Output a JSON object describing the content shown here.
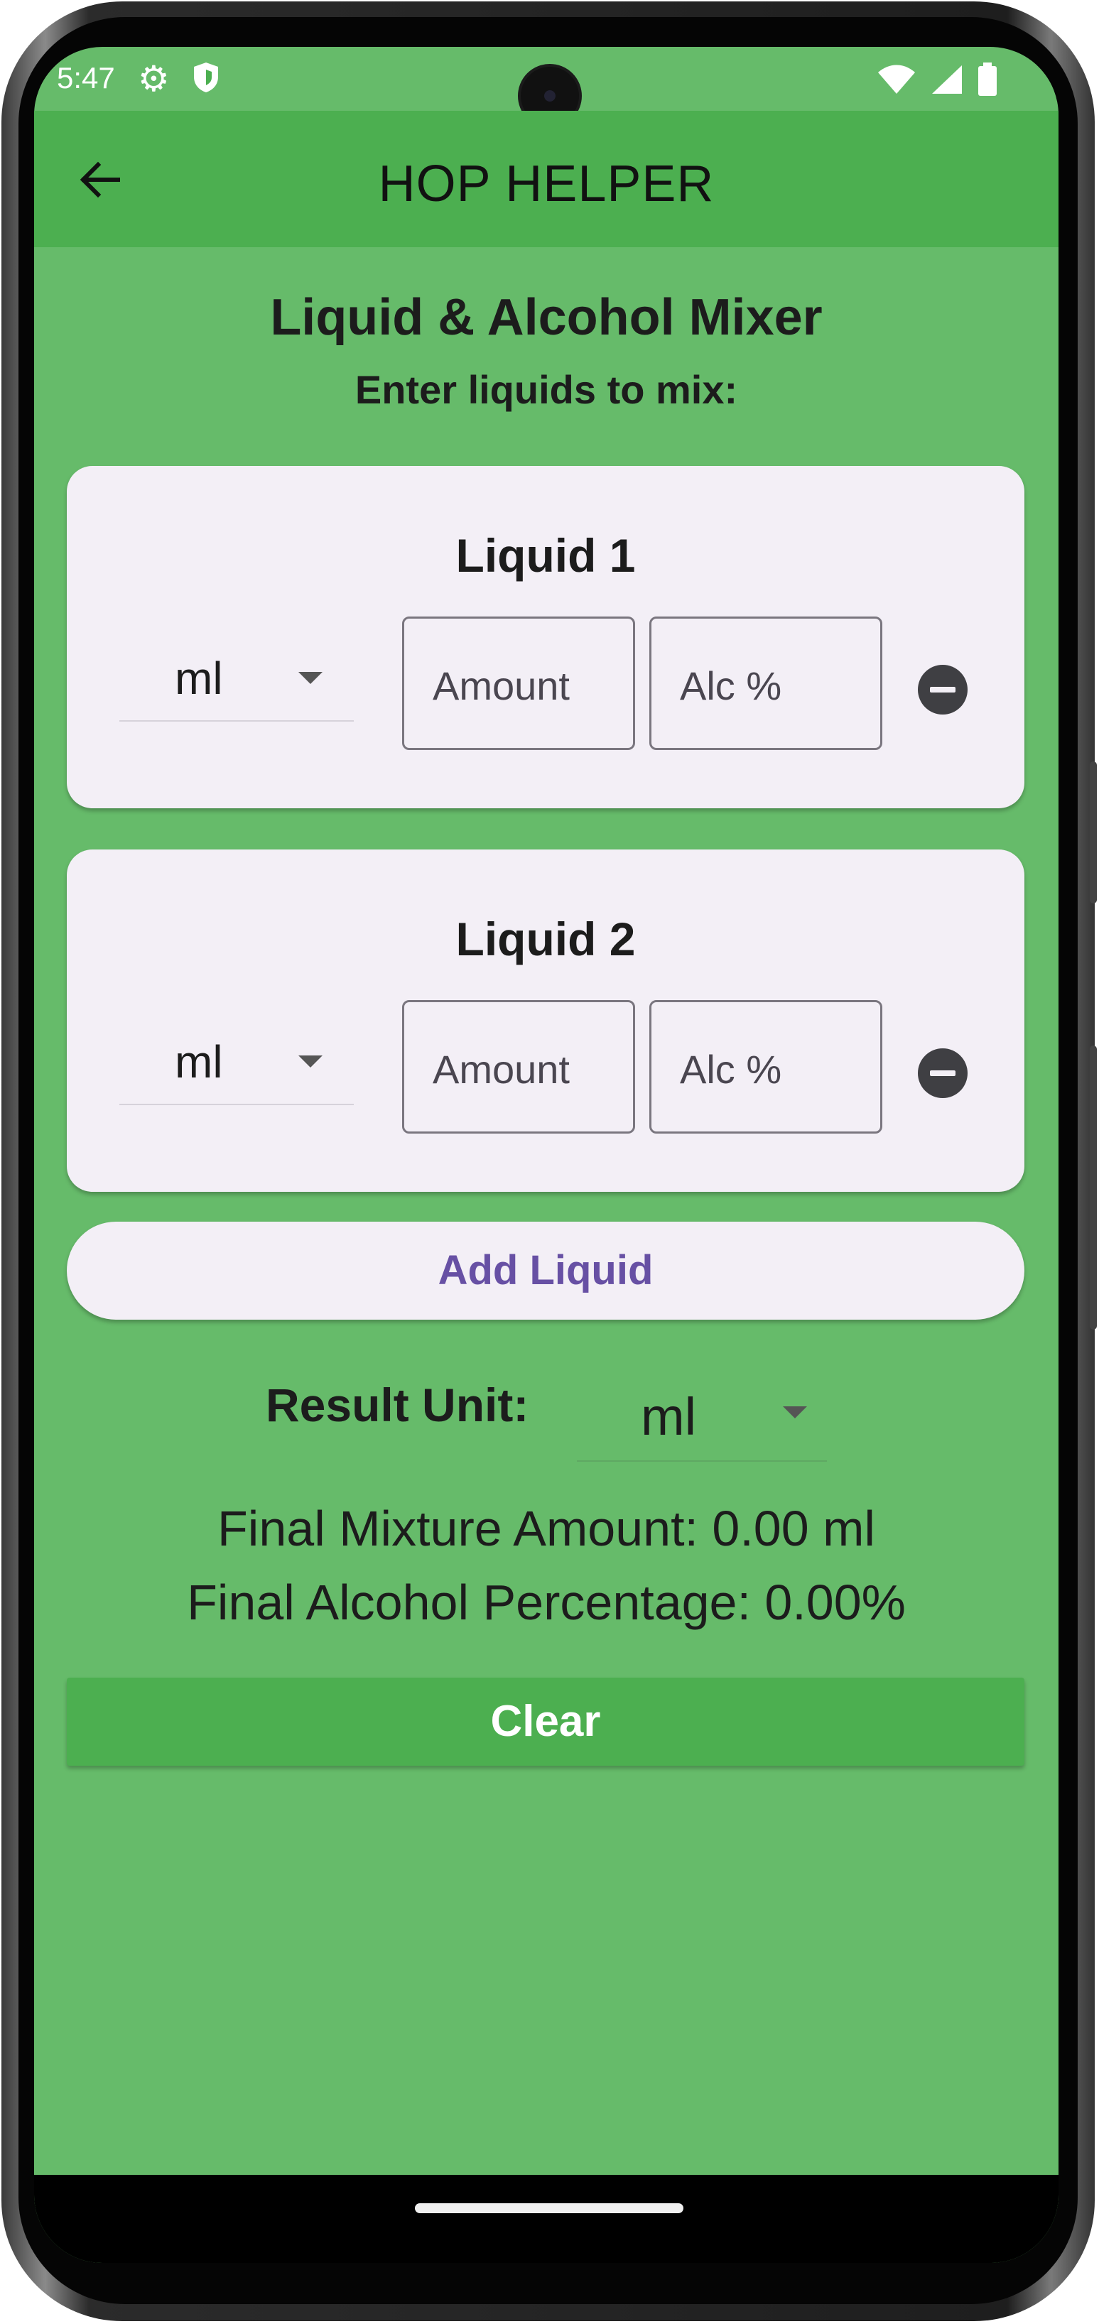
{
  "status_bar": {
    "time": "5:47",
    "icons": [
      "gear-icon",
      "shield-icon",
      "wifi-icon",
      "signal-icon",
      "battery-icon"
    ]
  },
  "app_bar": {
    "title": "HOP HELPER",
    "back_icon": "arrow-back-icon"
  },
  "page": {
    "heading": "Liquid & Alcohol Mixer",
    "subheading": "Enter liquids to mix:"
  },
  "liquids": [
    {
      "title": "Liquid 1",
      "unit": "ml",
      "amount_placeholder": "Amount",
      "alc_placeholder": "Alc %"
    },
    {
      "title": "Liquid 2",
      "unit": "ml",
      "amount_placeholder": "Amount",
      "alc_placeholder": "Alc %"
    }
  ],
  "add_button": {
    "label": "Add Liquid"
  },
  "result": {
    "label": "Result Unit:",
    "unit": "ml",
    "final_amount": "Final Mixture Amount: 0.00 ml",
    "final_alcohol": "Final Alcohol Percentage: 0.00%"
  },
  "clear_button": {
    "label": "Clear"
  },
  "colors": {
    "app_bar": "#4caf50",
    "background": "#66bb6a",
    "card": "#f3eff6",
    "accent_text": "#6750a4",
    "clear_button": "#4caf50"
  }
}
